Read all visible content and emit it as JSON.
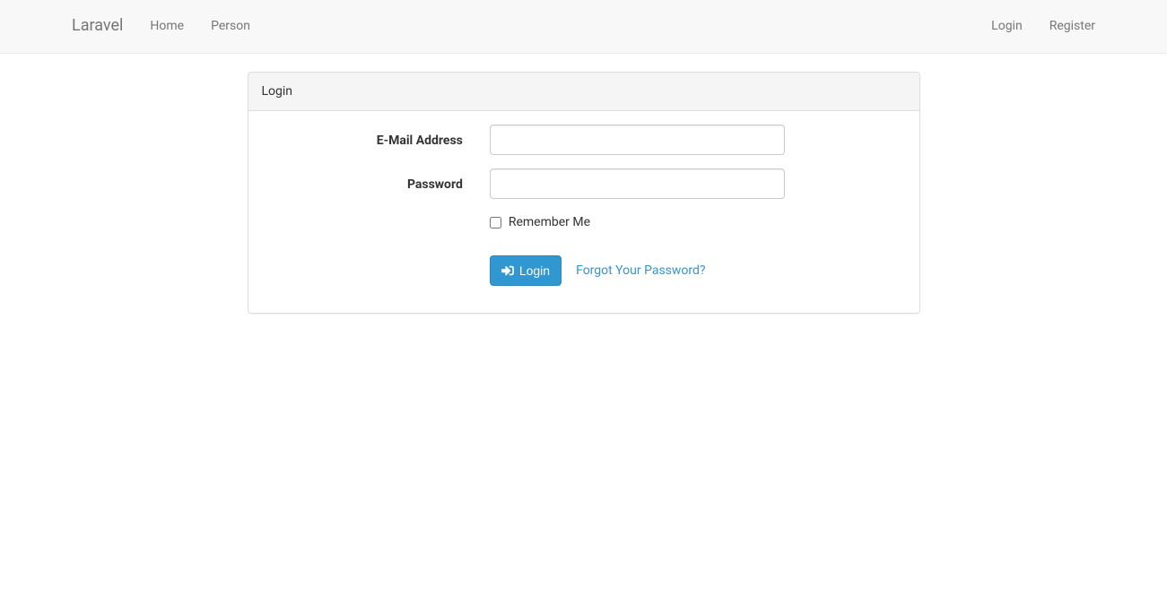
{
  "navbar": {
    "brand": "Laravel",
    "left_links": [
      {
        "label": "Home"
      },
      {
        "label": "Person"
      }
    ],
    "right_links": [
      {
        "label": "Login"
      },
      {
        "label": "Register"
      }
    ]
  },
  "panel": {
    "heading": "Login"
  },
  "form": {
    "email_label": "E-Mail Address",
    "email_value": "",
    "password_label": "Password",
    "password_value": "",
    "remember_label": "Remember Me",
    "submit_label": "Login",
    "forgot_label": "Forgot Your Password?"
  }
}
